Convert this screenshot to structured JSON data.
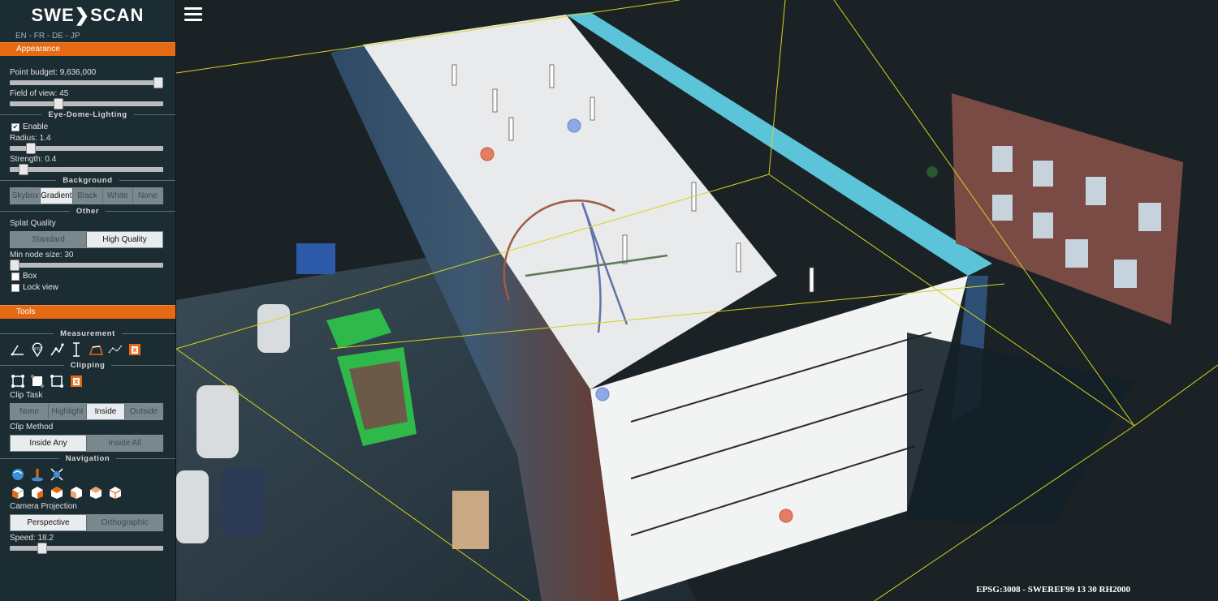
{
  "app": {
    "logo": "SWE❯SCAN",
    "crs_text": "EPSG:3008 - SWEREF99 13 30 RH2000"
  },
  "languages": [
    "EN",
    "FR",
    "DE",
    "JP"
  ],
  "appearance": {
    "header": "Appearance",
    "point_budget_label": "Point budget: 9,636,000",
    "point_budget_fraction": 0.97,
    "fov_label": "Field of view: 45",
    "fov_fraction": 0.3,
    "edl": {
      "header": "Eye-Dome-Lighting",
      "enable_label": "Enable",
      "enabled": true,
      "radius_label": "Radius: 1.4",
      "radius_fraction": 0.13,
      "strength_label": "Strength: 0.4",
      "strength_fraction": 0.08
    },
    "background": {
      "header": "Background",
      "options": [
        "Skybox",
        "Gradient",
        "Black",
        "White",
        "None"
      ],
      "selected": "Gradient"
    },
    "other": {
      "header": "Other",
      "splat_label": "Splat Quality",
      "splat_options": [
        "Standard",
        "High Quality"
      ],
      "splat_selected": "High Quality",
      "min_node_label": "Min node size: 30",
      "min_node_fraction": 0.0,
      "box_label": "Box",
      "lock_label": "Lock view"
    }
  },
  "tools": {
    "header": "Tools",
    "measurement_header": "Measurement",
    "clipping_header": "Clipping",
    "clip_task_label": "Clip Task",
    "clip_task_options": [
      "None",
      "Highlight",
      "Inside",
      "Outside"
    ],
    "clip_task_selected": "Inside",
    "clip_method_label": "Clip Method",
    "clip_method_options": [
      "Inside Any",
      "Inside All"
    ],
    "clip_method_selected": "Inside Any",
    "navigation_header": "Navigation",
    "camera_label": "Camera Projection",
    "camera_options": [
      "Perspective",
      "Orthographic"
    ],
    "camera_selected": "Perspective",
    "speed_label": "Speed: 18.2",
    "speed_fraction": 0.2
  },
  "colors": {
    "accent": "#e56a13",
    "sidebar": "#1c2c33",
    "bbox": "#d8d21a"
  }
}
